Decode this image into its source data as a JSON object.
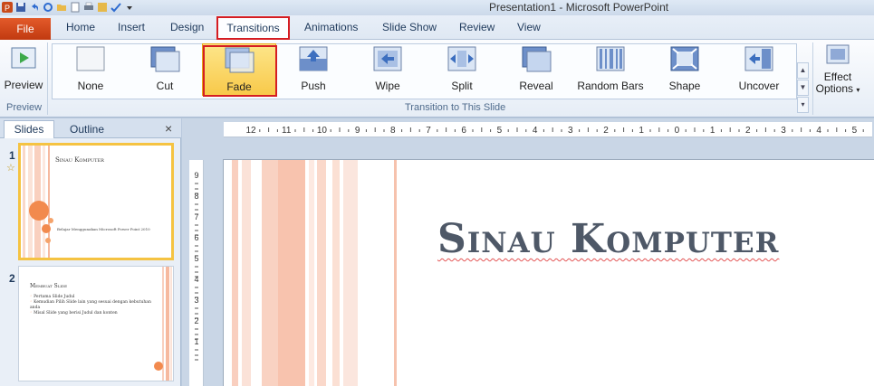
{
  "window": {
    "title": "Presentation1  -  Microsoft PowerPoint"
  },
  "ribbon_tabs": [
    {
      "label": "File"
    },
    {
      "label": "Home"
    },
    {
      "label": "Insert"
    },
    {
      "label": "Design"
    },
    {
      "label": "Transitions"
    },
    {
      "label": "Animations"
    },
    {
      "label": "Slide Show"
    },
    {
      "label": "Review"
    },
    {
      "label": "View"
    }
  ],
  "preview": {
    "button_label": "Preview",
    "group_label": "Preview"
  },
  "transitions": {
    "group_label": "Transition to This Slide",
    "selected": "Fade",
    "items": [
      {
        "label": "None",
        "icon": "none-transition-icon"
      },
      {
        "label": "Cut",
        "icon": "cut-transition-icon"
      },
      {
        "label": "Fade",
        "icon": "fade-transition-icon"
      },
      {
        "label": "Push",
        "icon": "push-transition-icon"
      },
      {
        "label": "Wipe",
        "icon": "wipe-transition-icon"
      },
      {
        "label": "Split",
        "icon": "split-transition-icon"
      },
      {
        "label": "Reveal",
        "icon": "reveal-transition-icon"
      },
      {
        "label": "Random Bars",
        "icon": "random-bars-transition-icon"
      },
      {
        "label": "Shape",
        "icon": "shape-transition-icon"
      },
      {
        "label": "Uncover",
        "icon": "uncover-transition-icon"
      }
    ]
  },
  "effect_options": {
    "label_line1": "Effect",
    "label_line2": "Options"
  },
  "left_pane": {
    "tabs": [
      {
        "label": "Slides"
      },
      {
        "label": "Outline"
      }
    ],
    "close_glyph": "×",
    "thumbnails": [
      {
        "number": "1",
        "title": "Sinau Komputer",
        "subtitle": "Belajar  Menggunakan  Microsoft  Power Point 2010"
      },
      {
        "number": "2",
        "title": "Membuat Slide",
        "bullets": [
          "Pertama  Slide Judul",
          "Kemudian Pilih Slide lain yang sesuai dengan kebutuhan anda",
          "Misal Slide yang berisi Judul dan konten"
        ]
      }
    ]
  },
  "ruler": {
    "horizontal": [
      "12",
      "11",
      "10",
      "9",
      "8",
      "7",
      "6",
      "5",
      "4",
      "3",
      "2",
      "1",
      "0",
      "1",
      "2",
      "3",
      "4",
      "5"
    ],
    "vertical": [
      "9",
      "8",
      "7",
      "6",
      "5",
      "4",
      "3",
      "2",
      "1"
    ]
  },
  "slide": {
    "title": "Sinau Komputer"
  },
  "colors": {
    "file_tab": "#d24726",
    "accent_orange": "#f28a4e",
    "stripe_pink": "#f9c9b6",
    "highlight_red": "#d51d22",
    "selected_item": "#f8d65a"
  }
}
